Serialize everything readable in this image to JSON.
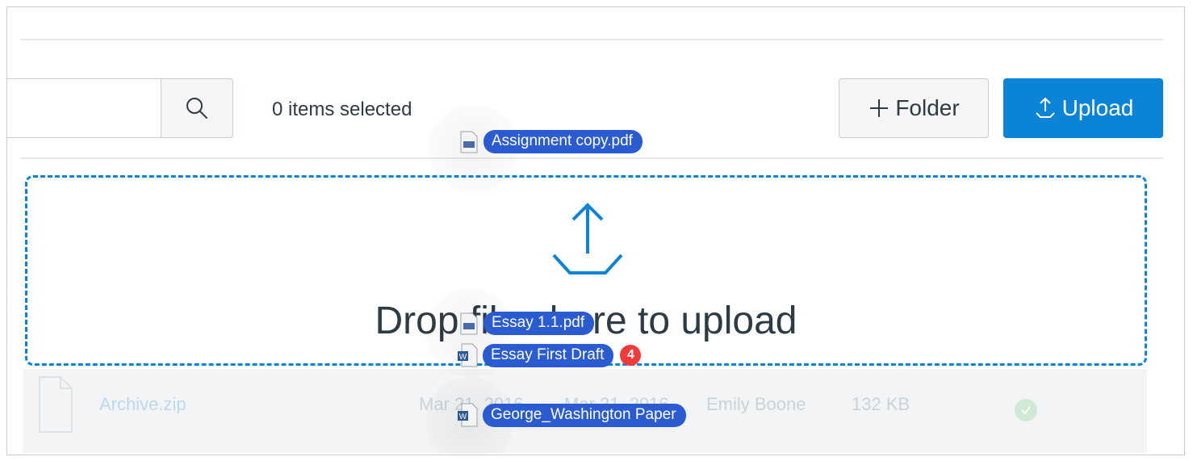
{
  "toolbar": {
    "search_placeholder": "",
    "selected_count": "0 items selected",
    "folder_label": "Folder",
    "upload_label": "Upload"
  },
  "drop_zone": {
    "message": "Drop files here to upload"
  },
  "file_row": {
    "name": "Archive.zip",
    "created": "Mar 21, 2016",
    "modified": "Mar 21, 2016",
    "modified_by": "Emily Boone",
    "size": "132 KB"
  },
  "drag_items": [
    {
      "name": "Assignment copy.pdf",
      "icon": "pdf-file-icon"
    },
    {
      "name": "Essay 1.1.pdf",
      "icon": "pdf-file-icon"
    },
    {
      "name": "Essay First Draft",
      "icon": "word-file-icon",
      "badge": "4"
    },
    {
      "name": "George_Washington Paper",
      "icon": "word-file-icon"
    }
  ],
  "colors": {
    "accent": "#0b84d8",
    "drag_label": "#2b5bd1",
    "badge": "#f23a3a"
  }
}
